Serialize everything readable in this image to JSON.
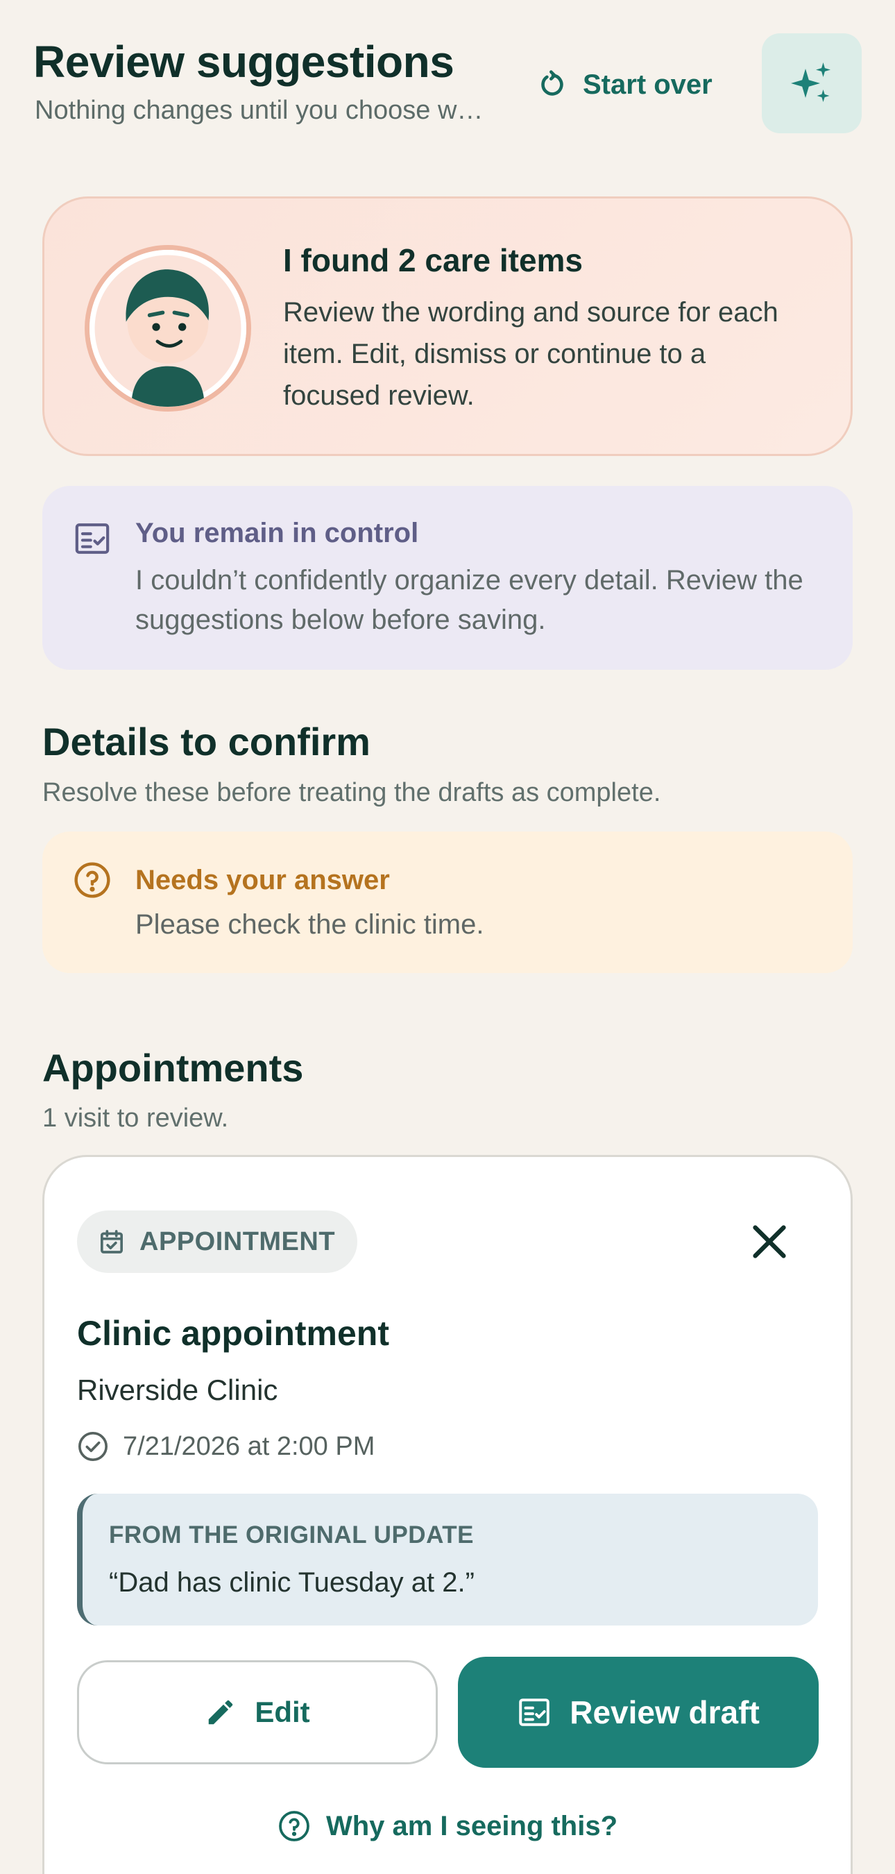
{
  "header": {
    "title": "Review suggestions",
    "subtitle": "Nothing changes until you choose w…",
    "start_over_label": "Start over",
    "ai_icon": "sparkles-icon"
  },
  "intro": {
    "title": "I found 2 care items",
    "body": "Review the wording and source for each item. Edit, dismiss or continue to a focused review."
  },
  "control_notice": {
    "title": "You remain in control",
    "body": "I couldn’t confidently organize every detail. Review the suggestions below before saving.",
    "icon": "checklist-icon"
  },
  "details": {
    "title": "Details to confirm",
    "subtitle": "Resolve these before treating the drafts as complete.",
    "needs": {
      "title": "Needs your answer",
      "body": "Please check the clinic time.",
      "icon": "question-circle-icon"
    }
  },
  "appointments": {
    "title": "Appointments",
    "subtitle": "1 visit to review.",
    "card": {
      "pill_label": "APPOINTMENT",
      "title": "Clinic appointment",
      "location": "Riverside Clinic",
      "datetime": "7/21/2026 at 2:00 PM",
      "quote_label": "FROM THE ORIGINAL UPDATE",
      "quote_text": "“Dad has clinic Tuesday at 2.”",
      "edit_label": "Edit",
      "review_label": "Review draft",
      "why_label": "Why am I seeing this?"
    }
  },
  "colors": {
    "background": "#F6F2EC",
    "primary": "#1D8178",
    "primary_text": "#166A5E",
    "warning": "#B5731F",
    "notice": "#5F5E87"
  }
}
